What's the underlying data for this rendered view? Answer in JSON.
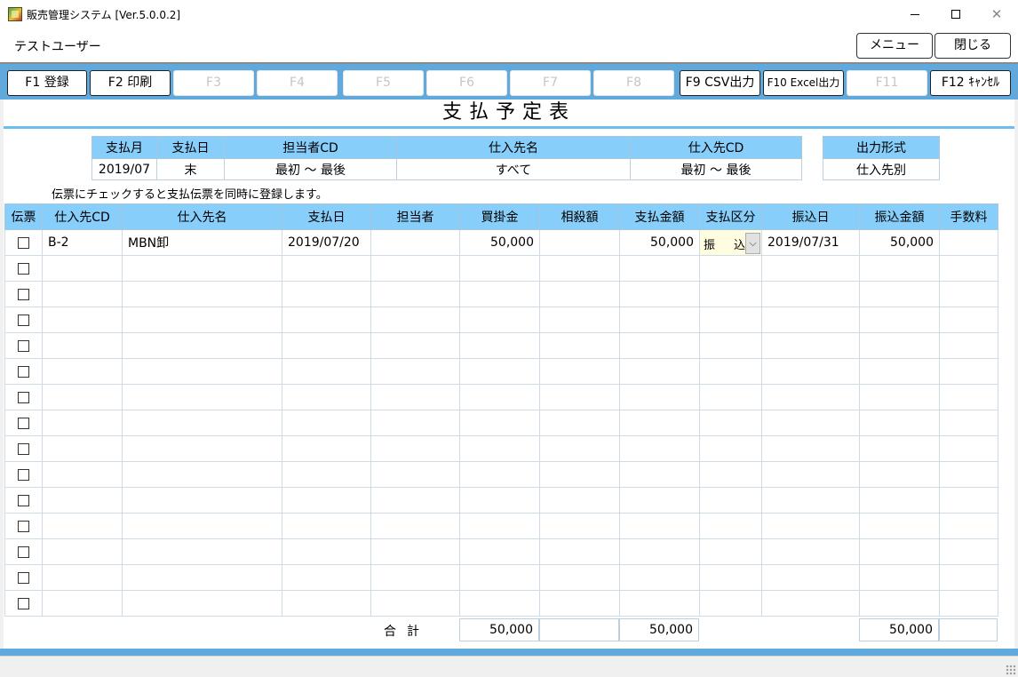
{
  "window": {
    "title": "販売管理システム [Ver.5.0.0.2]",
    "minimize_glyph": "—",
    "close_glyph": "✕"
  },
  "header": {
    "user": "テストユーザー",
    "menu_label": "メニュー",
    "close_label": "閉じる"
  },
  "fkeys": [
    {
      "label": "F1 登録",
      "enabled": true
    },
    {
      "label": "F2 印刷",
      "enabled": true
    },
    {
      "label": "F3",
      "enabled": false
    },
    {
      "label": "F4",
      "enabled": false
    },
    {
      "label": "F5",
      "enabled": false
    },
    {
      "label": "F6",
      "enabled": false
    },
    {
      "label": "F7",
      "enabled": false
    },
    {
      "label": "F8",
      "enabled": false
    },
    {
      "label": "F9 CSV出力",
      "enabled": true
    },
    {
      "label": "F10 Excel出力",
      "enabled": true
    },
    {
      "label": "F11",
      "enabled": false
    },
    {
      "label": "F12 ｷｬﾝｾﾙ",
      "enabled": true
    }
  ],
  "page_title": "支払予定表",
  "conditions": {
    "headers": [
      "支払月",
      "支払日",
      "担当者CD",
      "仕入先名",
      "仕入先CD"
    ],
    "values": [
      "2019/07",
      "末",
      "最初 ～ 最後",
      "すべて",
      "最初 ～ 最後"
    ],
    "output_header": "出力形式",
    "output_value": "仕入先別"
  },
  "note": "伝票にチェックすると支払伝票を同時に登録します。",
  "grid": {
    "headers": [
      "伝票",
      "仕入先CD",
      "仕入先名",
      "支払日",
      "担当者",
      "買掛金",
      "相殺額",
      "支払金額",
      "支払区分",
      "振込日",
      "振込金額",
      "手数料"
    ],
    "rows": [
      {
        "checked": false,
        "supplier_cd": "B-2",
        "supplier_name": "MBN卸",
        "pay_date": "2019/07/20",
        "staff": "",
        "payable": "50,000",
        "offset": "",
        "pay_amount": "50,000",
        "pay_type": "振　込",
        "transfer_date": "2019/07/31",
        "transfer_amount": "50,000",
        "fee": ""
      }
    ],
    "empty_row_count": 14
  },
  "totals": {
    "label": "合計",
    "payable": "50,000",
    "pay_amount": "50,000",
    "transfer_amount": "50,000"
  },
  "colors": {
    "accent": "#5fa9dd",
    "header_fill": "#87cefa",
    "select_fill": "#fffde0"
  }
}
